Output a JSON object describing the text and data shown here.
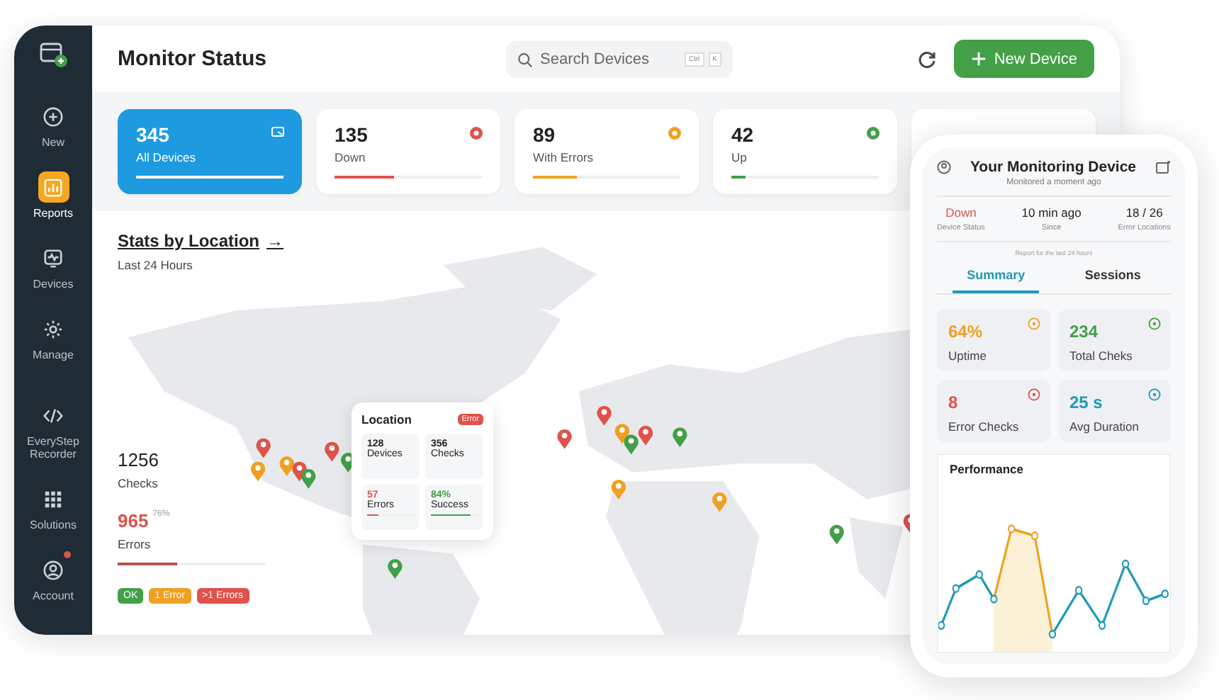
{
  "sidebar": {
    "items": [
      {
        "kind": "new",
        "label": "New",
        "selected": false,
        "notification": false
      },
      {
        "kind": "reports",
        "label": "Reports",
        "selected": true,
        "notification": false
      },
      {
        "kind": "devices",
        "label": "Devices",
        "selected": false,
        "notification": false
      },
      {
        "kind": "manage",
        "label": "Manage",
        "selected": false,
        "notification": false
      },
      {
        "kind": "recorder",
        "label": "EveryStep Recorder",
        "selected": false,
        "notification": false
      },
      {
        "kind": "solutions",
        "label": "Solutions",
        "selected": false,
        "notification": false
      },
      {
        "kind": "account",
        "label": "Account",
        "selected": false,
        "notification": true
      }
    ]
  },
  "header": {
    "title": "Monitor Status",
    "search": {
      "placeholder": "Search Devices",
      "keys": [
        "Ctrl",
        "K"
      ]
    },
    "button": "New Device"
  },
  "stats": [
    {
      "value": "345",
      "label": "All Devices",
      "selected": true,
      "level": 1,
      "color": "#ffffff"
    },
    {
      "value": "135",
      "label": "Down",
      "selected": false,
      "level": 0.4,
      "color": "#e0524a"
    },
    {
      "value": "89",
      "label": "With Errors",
      "selected": false,
      "level": 0.3,
      "color": "#f0a020"
    },
    {
      "value": "42",
      "label": "Up",
      "selected": false,
      "level": 0.1,
      "color": "#43a047"
    }
  ],
  "location": {
    "title": "Stats by Location",
    "arrow": "→",
    "subtitle": "Last 24 Hours",
    "checks": "1256",
    "checks_label": "Checks",
    "errors": "965",
    "errors_percent": "76%",
    "errors_label": "Errors",
    "level": 0.4,
    "legend": [
      {
        "label": "OK",
        "color": "#43a047"
      },
      {
        "label": "1 Error",
        "color": "#f0a020"
      },
      {
        "label": ">1 Errors",
        "color": "#e0524a"
      }
    ]
  },
  "popup": {
    "title": "Location",
    "badge": "Error",
    "cells": [
      {
        "value": "128",
        "label": "Devices"
      },
      {
        "value": "356",
        "label": "Checks"
      },
      {
        "value": "57",
        "label": "Errors",
        "level": 0.25,
        "color": "#e0524a"
      },
      {
        "value": "84%",
        "label": "Success",
        "level": 0.84,
        "color": "#43a047"
      }
    ]
  },
  "phone": {
    "title": "Your Monitoring Device",
    "subtitle": "Monitored a moment ago",
    "facts": [
      {
        "value": "Down",
        "label": "Device Status",
        "color": "#d9534f"
      },
      {
        "value": "10 min ago",
        "label": "Since",
        "color": "#222222"
      },
      {
        "value": "18 / 26",
        "label": "Error Locations",
        "color": "#222222"
      }
    ],
    "note": "Report for the last 24 hours",
    "tabs": [
      {
        "label": "Summary",
        "selected": true
      },
      {
        "label": "Sessions",
        "selected": false
      }
    ],
    "metrics": [
      {
        "value": "64%",
        "label": "Uptime",
        "color": "#f0a020"
      },
      {
        "value": "234",
        "label": "Total Cheks",
        "color": "#43a047"
      },
      {
        "value": "8",
        "label": "Error Checks",
        "color": "#e0524a"
      },
      {
        "value": "25 s",
        "label": "Avg Duration",
        "color": "#1e9bb8"
      }
    ],
    "chart_title": "Performance"
  }
}
